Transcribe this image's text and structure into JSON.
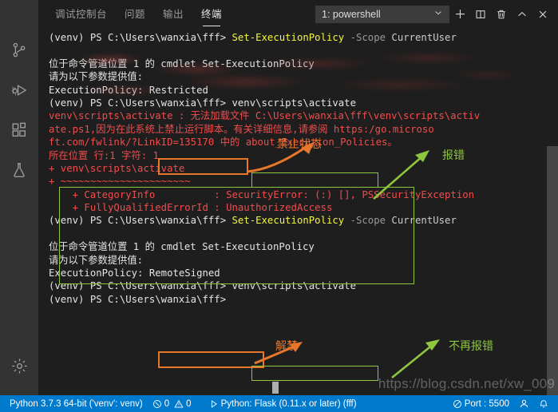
{
  "window": {
    "app": "vscode-terminal-panel",
    "watermark": "https://blog.csdn.net/xw_009"
  },
  "activity_bar": {
    "items": [
      {
        "name": "source-control-icon",
        "label": "源代码管理"
      },
      {
        "name": "run-debug-icon",
        "label": "运行和调试"
      },
      {
        "name": "extensions-icon",
        "label": "扩展"
      },
      {
        "name": "testing-icon",
        "label": "测试"
      }
    ],
    "bottom": {
      "name": "manage-gear-icon",
      "label": "管理"
    }
  },
  "panel": {
    "tabs": [
      {
        "label": "调试控制台",
        "active": false
      },
      {
        "label": "问题",
        "active": false
      },
      {
        "label": "输出",
        "active": false
      },
      {
        "label": "终端",
        "active": true
      }
    ],
    "terminal_select": {
      "value": "1: powershell",
      "chevron": "chevron-down-icon"
    },
    "actions": [
      {
        "name": "new-terminal-icon",
        "label": "新建终端"
      },
      {
        "name": "split-terminal-icon",
        "label": "拆分终端"
      },
      {
        "name": "kill-terminal-icon",
        "label": "终止终端"
      },
      {
        "name": "maximize-panel-icon",
        "label": "最大化面板大小"
      },
      {
        "name": "close-panel-icon",
        "label": "关闭面板"
      }
    ]
  },
  "terminal": {
    "prompt": "(venv) PS C:\\Users\\wanxia\\fff>",
    "lines": [
      {
        "id": "l01",
        "segments": [
          {
            "t": "(venv) PS C:\\Users\\wanxia\\fff> ",
            "c": "c-white"
          },
          {
            "t": "Set-ExecutionPolicy",
            "c": "c-yellow"
          },
          {
            "t": " -Scope",
            "c": "c-dim"
          },
          {
            "t": " CurrentUser",
            "c": "c-grey"
          }
        ]
      },
      {
        "id": "l02",
        "segments": []
      },
      {
        "id": "l03",
        "segments": [
          {
            "t": "位于命令管道位置 1 的 cmdlet Set-ExecutionPolicy",
            "c": "c-white"
          }
        ]
      },
      {
        "id": "l04",
        "segments": [
          {
            "t": "请为以下参数提供值:",
            "c": "c-white"
          }
        ]
      },
      {
        "id": "l05",
        "segments": [
          {
            "t": "ExecutionPolicy: Restricted",
            "c": "c-white"
          }
        ]
      },
      {
        "id": "l06",
        "segments": [
          {
            "t": "(venv) PS C:\\Users\\wanxia\\fff> venv\\scripts\\activate",
            "c": "c-white"
          }
        ]
      },
      {
        "id": "l07",
        "segments": [
          {
            "t": "venv\\scripts\\activate : 无法加载文件 C:\\Users\\wanxia\\fff\\venv\\scripts\\activ",
            "c": "c-red"
          }
        ]
      },
      {
        "id": "l08",
        "segments": [
          {
            "t": "ate.ps1,因为在此系统上禁止运行脚本。有关详细信息,请参阅 https:/go.microso",
            "c": "c-red"
          }
        ]
      },
      {
        "id": "l09",
        "segments": [
          {
            "t": "ft.com/fwlink/?LinkID=135170 中的 about_Execution_Policies。",
            "c": "c-red"
          }
        ]
      },
      {
        "id": "l10",
        "segments": [
          {
            "t": "所在位置 行:1 字符: 1",
            "c": "c-red"
          }
        ]
      },
      {
        "id": "l11",
        "segments": [
          {
            "t": "+ venv\\scripts\\activate",
            "c": "c-red"
          }
        ]
      },
      {
        "id": "l12",
        "segments": [
          {
            "t": "+ ~~~~~~~~~~~~~~~~~~~~~~",
            "c": "c-red"
          }
        ]
      },
      {
        "id": "l13",
        "segments": [
          {
            "t": "    + CategoryInfo          : SecurityError: (:) [], PSSecurityException",
            "c": "c-red"
          }
        ]
      },
      {
        "id": "l14",
        "segments": [
          {
            "t": "    + FullyQualifiedErrorId : UnauthorizedAccess",
            "c": "c-red"
          }
        ]
      },
      {
        "id": "l15",
        "segments": [
          {
            "t": "(venv) PS C:\\Users\\wanxia\\fff> ",
            "c": "c-white"
          },
          {
            "t": "Set-ExecutionPolicy",
            "c": "c-yellow"
          },
          {
            "t": " -Scope",
            "c": "c-dim"
          },
          {
            "t": " CurrentUser",
            "c": "c-grey"
          }
        ]
      },
      {
        "id": "l16",
        "segments": []
      },
      {
        "id": "l17",
        "segments": [
          {
            "t": "位于命令管道位置 1 的 cmdlet Set-ExecutionPolicy",
            "c": "c-white"
          }
        ]
      },
      {
        "id": "l18",
        "segments": [
          {
            "t": "请为以下参数提供值:",
            "c": "c-white"
          }
        ]
      },
      {
        "id": "l19",
        "segments": [
          {
            "t": "ExecutionPolicy: RemoteSigned",
            "c": "c-white"
          }
        ]
      },
      {
        "id": "l20",
        "segments": [
          {
            "t": "(venv) PS C:\\Users\\wanxia\\fff> venv\\scripts\\activate",
            "c": "c-white"
          }
        ]
      },
      {
        "id": "l21",
        "segments": [
          {
            "t": "(venv) PS C:\\Users\\wanxia\\fff>",
            "c": "c-white"
          }
        ]
      }
    ]
  },
  "annotations": {
    "colors": {
      "orange": "#e8762b",
      "green": "#8ec63f"
    },
    "labels": [
      {
        "id": "a1",
        "text": "禁止状态",
        "color": "orange"
      },
      {
        "id": "a2",
        "text": "报错",
        "color": "green"
      },
      {
        "id": "a3",
        "text": "解禁",
        "color": "orange"
      },
      {
        "id": "a4",
        "text": "不再报错",
        "color": "green"
      }
    ]
  },
  "status_bar": {
    "python": "Python 3.7.3 64-bit ('venv': venv)",
    "errors": "0",
    "warnings": "0",
    "run_config": "Python: Flask (0.11.x or later) (fff)",
    "port": "Port : 5500",
    "icons": {
      "error": "error-circle-icon",
      "warning": "warning-triangle-icon",
      "play": "play-icon",
      "broadcast": "live-server-icon",
      "account": "account-icon",
      "bell": "bell-icon"
    }
  }
}
